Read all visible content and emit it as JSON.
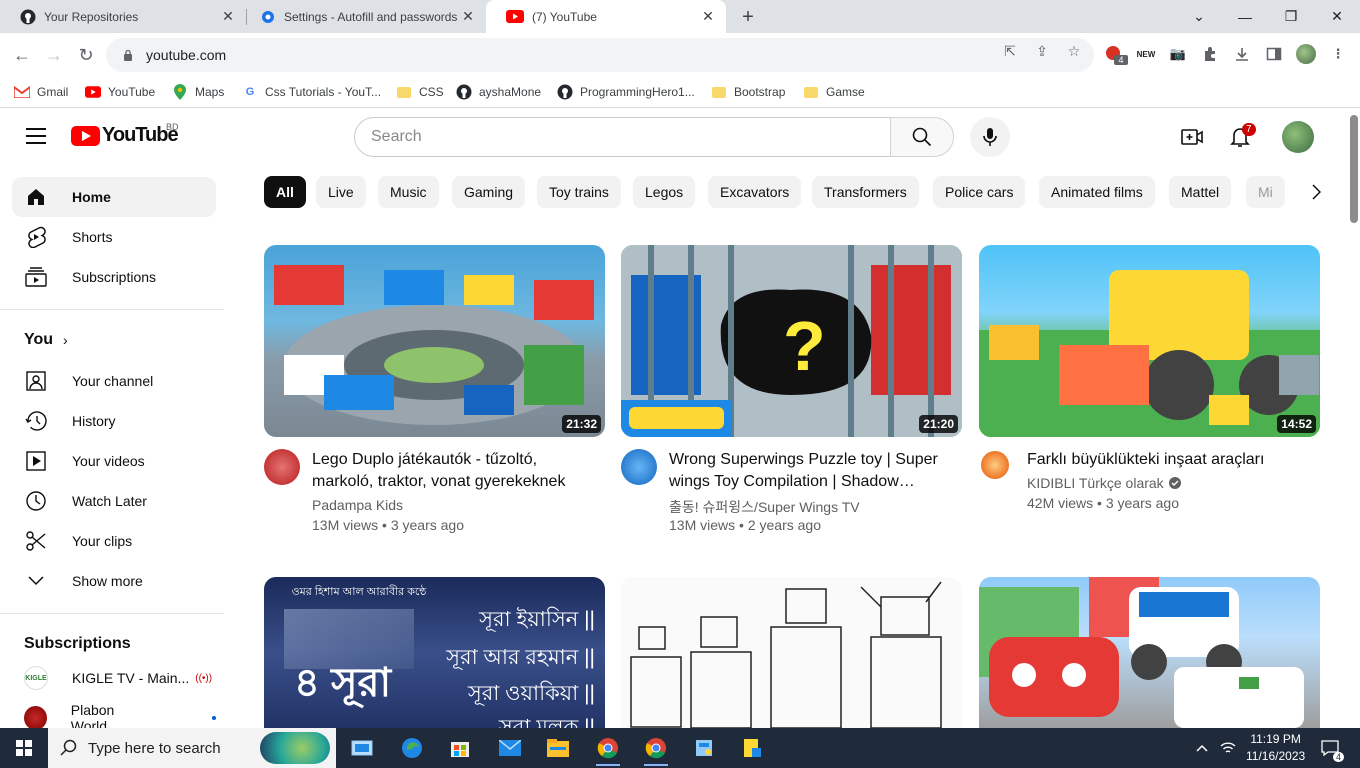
{
  "browser": {
    "tabs": [
      {
        "title": "Your Repositories",
        "icon": "github-icon"
      },
      {
        "title": "Settings - Autofill and passwords",
        "icon": "settings-gear-icon"
      },
      {
        "title": "(7) YouTube",
        "icon": "youtube-icon"
      }
    ],
    "url": "youtube.com",
    "extension_badge": "4",
    "bookmarks": [
      {
        "label": "Gmail",
        "icon": "gmail-icon"
      },
      {
        "label": "YouTube",
        "icon": "youtube-icon"
      },
      {
        "label": "Maps",
        "icon": "maps-icon"
      },
      {
        "label": "Css Tutorials - YouT...",
        "icon": "google-icon"
      },
      {
        "label": "CSS",
        "icon": "folder-icon"
      },
      {
        "label": "ayshaMone",
        "icon": "github-icon"
      },
      {
        "label": "ProgrammingHero1...",
        "icon": "github-icon"
      },
      {
        "label": "Bootstrap",
        "icon": "folder-icon"
      },
      {
        "label": "Gamse",
        "icon": "folder-icon"
      }
    ]
  },
  "youtube": {
    "logo_text": "YouTube",
    "country": "BD",
    "search_placeholder": "Search",
    "notification_count": "7",
    "sidebar": {
      "main": [
        {
          "label": "Home",
          "icon": "home-icon"
        },
        {
          "label": "Shorts",
          "icon": "shorts-icon"
        },
        {
          "label": "Subscriptions",
          "icon": "subscriptions-icon"
        }
      ],
      "you_heading": "You",
      "you_items": [
        {
          "label": "Your channel",
          "icon": "your-channel-icon"
        },
        {
          "label": "History",
          "icon": "history-icon"
        },
        {
          "label": "Your videos",
          "icon": "your-videos-icon"
        },
        {
          "label": "Watch Later",
          "icon": "watch-later-icon"
        },
        {
          "label": "Your clips",
          "icon": "clips-icon"
        },
        {
          "label": "Show more",
          "icon": "chevron-down-icon"
        }
      ],
      "subscriptions_heading": "Subscriptions",
      "subscriptions": [
        {
          "label": "KIGLE TV - Main...",
          "badge": "live"
        },
        {
          "label": "Plabon World",
          "badge": "new"
        }
      ]
    },
    "chips": [
      "All",
      "Live",
      "Music",
      "Gaming",
      "Toy trains",
      "Legos",
      "Excavators",
      "Transformers",
      "Police cars",
      "Animated films",
      "Mattel",
      "Mi"
    ],
    "videos": [
      {
        "title": "Lego Duplo játékautók - tűzoltó, markoló, traktor, vonat gyerekeknek",
        "channel": "Padampa Kids",
        "views": "13M views",
        "age": "3 years ago",
        "duration": "21:32",
        "verified": false
      },
      {
        "title": "Wrong Superwings Puzzle toy | Super wings Toy Compilation | Shadow…",
        "channel": "출동! 슈퍼윙스/Super Wings TV",
        "views": "13M views",
        "age": "2 years ago",
        "duration": "21:20",
        "verified": false
      },
      {
        "title": "Farklı büyüklükteki inşaat araçları",
        "channel": "KIDIBLI Türkçe olarak",
        "views": "42M views",
        "age": "3 years ago",
        "duration": "14:52",
        "verified": true
      }
    ],
    "row2_thumb_text": {
      "line1": "ওমর হিশাম আল আরাবীর কন্ঠে",
      "big": "৪ সূরা",
      "s1": "সূরা ইয়াসিন ||",
      "s2": "সূরা আর রহমান ||",
      "s3": "সূরা ওয়াকিয়া ||",
      "s4": "সূরা মুলক ||"
    }
  },
  "taskbar": {
    "search_placeholder": "Type here to search",
    "time": "11:19 PM",
    "date": "11/16/2023",
    "notification_count": "4"
  }
}
